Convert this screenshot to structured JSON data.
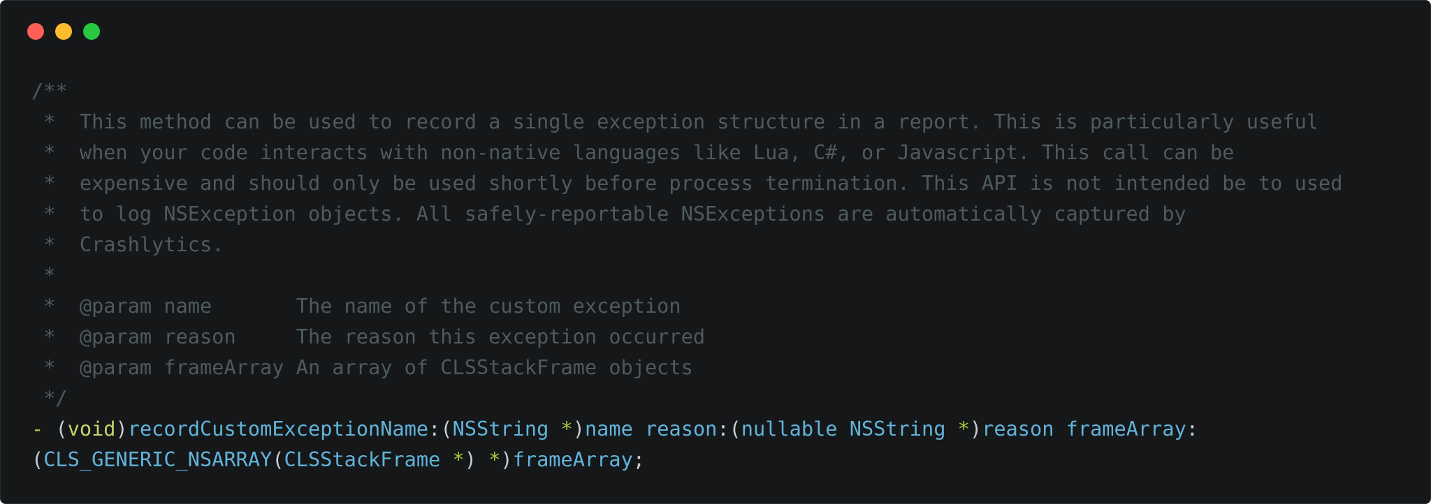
{
  "window": {
    "controls": [
      "close",
      "minimize",
      "zoom"
    ],
    "colors": {
      "background": "#151719",
      "close": "#ff5f57",
      "minimize": "#febc2e",
      "zoom": "#28c840"
    }
  },
  "code": {
    "comment_lines": [
      "/**",
      " *  This method can be used to record a single exception structure in a report. This is particularly useful",
      " *  when your code interacts with non-native languages like Lua, C#, or Javascript. This call can be",
      " *  expensive and should only be used shortly before process termination. This API is not intended be to used",
      " *  to log NSException objects. All safely-reportable NSExceptions are automatically captured by",
      " *  Crashlytics.",
      " *",
      " *  @param name       The name of the custom exception",
      " *  @param reason     The reason this exception occurred",
      " *  @param frameArray An array of CLSStackFrame objects",
      " */"
    ],
    "declaration": {
      "line1": {
        "dash": "- ",
        "open_paren": "(",
        "return_type": "void",
        "close_paren": ")",
        "method_part1": "recordCustomExceptionName",
        "colon1": ":(",
        "type1": "NSString",
        "space_star1": " *",
        "close1": ")",
        "arg1": "name",
        "sep1": " ",
        "method_part2": "reason",
        "colon2": ":(",
        "nullable": "nullable",
        "space_type2": " ",
        "type2": "NSString",
        "space_star2": " *",
        "close2": ")",
        "arg2": "reason",
        "sep2": " ",
        "method_part3": "frameArray",
        "colon3": ":"
      },
      "line2": {
        "open": "(",
        "macro": "CLS_GENERIC_NSARRAY",
        "macro_open": "(",
        "type3": "CLSStackFrame",
        "space_star3": " *",
        "macro_close": ") ",
        "star4": "*",
        "close3": ")",
        "arg3": "frameArray",
        "semicolon": ";"
      }
    }
  }
}
